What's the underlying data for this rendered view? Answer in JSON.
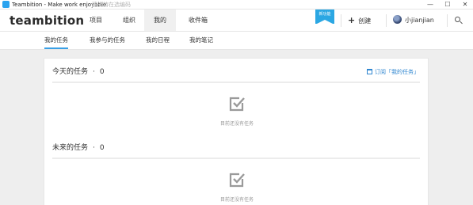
{
  "window": {
    "title": "Teambition - Make work enjoyable",
    "overlay_title": "建支持在选编码",
    "controls": {
      "minimize": "—",
      "maximize": "☐",
      "close": "✕"
    }
  },
  "header": {
    "logo": "teambition",
    "nav": [
      {
        "label": "项目"
      },
      {
        "label": "组织"
      },
      {
        "label": "我的"
      },
      {
        "label": "收件箱"
      }
    ],
    "active_nav": "我的",
    "new_feature_badge": "新功能",
    "create_label": "创建",
    "username": "小jianjian"
  },
  "subnav": {
    "tabs": [
      {
        "label": "我的任务"
      },
      {
        "label": "我参与的任务"
      },
      {
        "label": "我的日程"
      },
      {
        "label": "我的笔记"
      }
    ],
    "active_tab": "我的任务"
  },
  "main": {
    "sections": [
      {
        "title": "今天的任务",
        "count": "0",
        "empty_text": "目前还没有任务"
      },
      {
        "title": "未来的任务",
        "count": "0",
        "empty_text": "目前还没有任务"
      }
    ],
    "subscribe_label": "订阅「我的任务」"
  },
  "colors": {
    "accent": "#2ba7e3",
    "link": "#2f86d0",
    "background": "#eeeeee"
  },
  "icons": [
    "app-icon",
    "plus-icon",
    "avatar",
    "search-icon",
    "calendar-icon",
    "checkbox-icon"
  ]
}
